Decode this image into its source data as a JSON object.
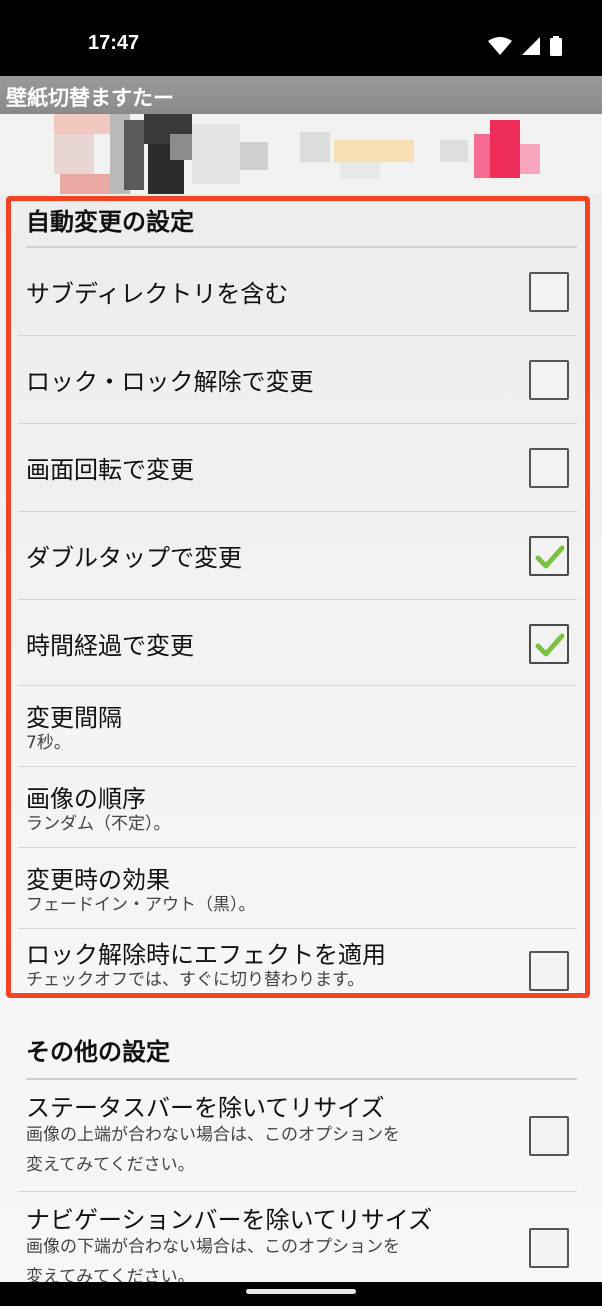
{
  "status_bar": {
    "time": "17:47",
    "icons": [
      "wifi-icon",
      "signal-icon",
      "battery-icon"
    ]
  },
  "app": {
    "title": "壁紙切替ますたー"
  },
  "auto_change": {
    "header": "自動変更の設定",
    "items": [
      {
        "label": "サブディレクトリを含む",
        "checked": false
      },
      {
        "label": "ロック・ロック解除で変更",
        "checked": false
      },
      {
        "label": "画面回転で変更",
        "checked": false
      },
      {
        "label": "ダブルタップで変更",
        "checked": true
      },
      {
        "label": "時間経過で変更",
        "checked": true
      },
      {
        "label": "変更間隔",
        "summary": "7秒。"
      },
      {
        "label": "画像の順序",
        "summary": "ランダム（不定）。"
      },
      {
        "label": "変更時の効果",
        "summary": "フェードイン・アウト（黒）。"
      },
      {
        "label": "ロック解除時にエフェクトを適用",
        "summary": "チェックオフでは、すぐに切り替わります。",
        "checked": false
      }
    ]
  },
  "other": {
    "header": "その他の設定",
    "items": [
      {
        "label": "ステータスバーを除いてリサイズ",
        "summary_line1": "画像の上端が合わない場合は、このオプションを",
        "summary_line2": "変えてみてください。",
        "checked": false
      },
      {
        "label": "ナビゲーションバーを除いてリサイズ",
        "summary_line1": "画像の下端が合わない場合は、このオプションを",
        "summary_line2": "変えてみてください。",
        "checked": false
      }
    ]
  },
  "colors": {
    "highlight_border": "#f24423",
    "check_green": "#7cc242",
    "titlebar": "#909090"
  }
}
